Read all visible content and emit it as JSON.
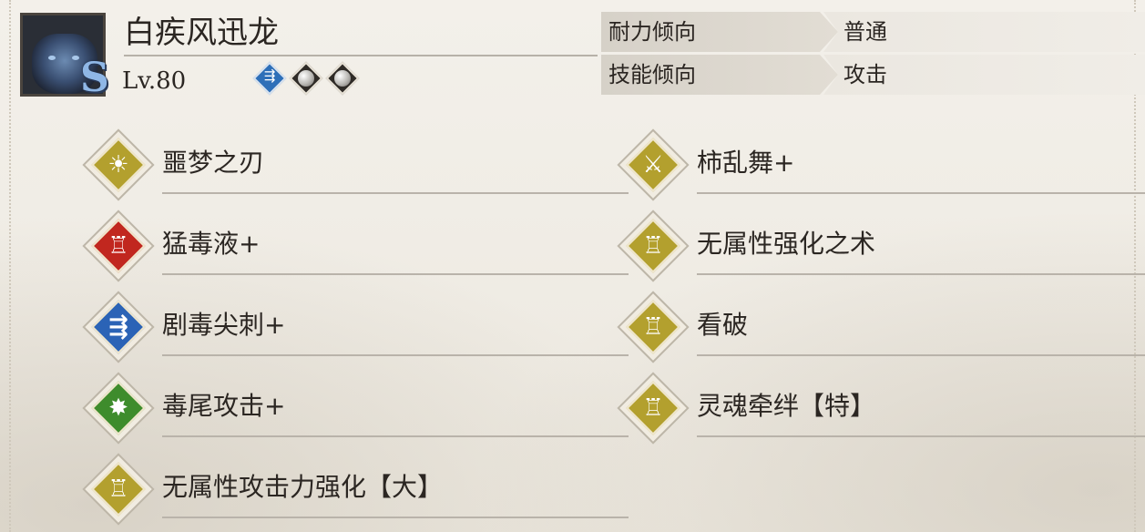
{
  "monster": {
    "name": "白疾风迅龙",
    "rank": "S",
    "level": "Lv.80",
    "slots": [
      {
        "type": "decoration",
        "color": "#2e6fb8",
        "icon": "speed-icon"
      },
      {
        "type": "empty-orb",
        "icon": "orb-icon"
      },
      {
        "type": "empty-orb",
        "icon": "orb-icon"
      }
    ]
  },
  "tendency": {
    "stamina_label": "耐力倾向",
    "stamina_value": "普通",
    "skill_label": "技能倾向",
    "skill_value": "攻击"
  },
  "skills_left": [
    {
      "name": "噩梦之刃",
      "color": "gold",
      "icon": "sun-burst-icon"
    },
    {
      "name": "猛毒液+",
      "color": "red",
      "icon": "flex-figure-icon"
    },
    {
      "name": "剧毒尖刺+",
      "color": "blue",
      "icon": "speed-figure-icon"
    },
    {
      "name": "毒尾攻击+",
      "color": "green",
      "icon": "burst-icon"
    },
    {
      "name": "无属性攻击力强化【大】",
      "color": "gold",
      "icon": "flex-figure-icon"
    }
  ],
  "skills_right": [
    {
      "name": "柿乱舞+",
      "color": "gold",
      "icon": "blade-icon"
    },
    {
      "name": "无属性强化之术",
      "color": "gold",
      "icon": "flex-figure-icon"
    },
    {
      "name": "看破",
      "color": "gold",
      "icon": "flex-figure-icon"
    },
    {
      "name": "灵魂牵绊【特】",
      "color": "gold",
      "icon": "flex-figure-icon"
    }
  ],
  "colors": {
    "gold": "#b3a02e",
    "red": "#c1271f",
    "blue": "#2b63b6",
    "green": "#3e8c2c"
  }
}
